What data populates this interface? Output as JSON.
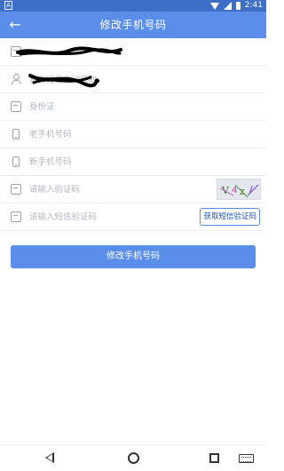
{
  "status_bar": {
    "left_icon": "android-notification-icon",
    "time": "2:41"
  },
  "app_bar": {
    "title": "修改手机号码",
    "back_icon": "back-arrow-icon"
  },
  "form": {
    "rows": [
      {
        "icon": "chat-icon",
        "value": ""
      },
      {
        "icon": "person-icon",
        "placeholder": "真实姓名自动获取"
      },
      {
        "icon": "chat-icon",
        "placeholder": "身份证"
      },
      {
        "icon": "phone-icon",
        "placeholder": "老手机号码"
      },
      {
        "icon": "phone-icon",
        "placeholder": "新手机号码"
      },
      {
        "icon": "chat-icon",
        "placeholder": "请输入验证码",
        "captcha_text": "V4zl"
      },
      {
        "icon": "chat-icon",
        "placeholder": "请输入短信验证码",
        "button": "获取短信验证码"
      }
    ]
  },
  "submit": {
    "label": "修改手机号码"
  },
  "colors": {
    "primary": "#5a8eea",
    "status_bar": "#3d6fc8",
    "divider": "#eceff3",
    "hint": "#b3b8c0"
  }
}
